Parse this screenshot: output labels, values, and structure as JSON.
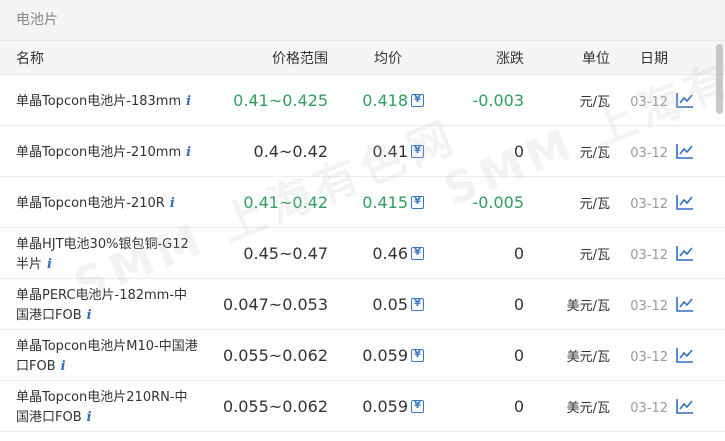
{
  "section_title": "电池片",
  "watermark": "SMM 上海有色网",
  "headers": {
    "name": "名称",
    "range": "价格范围",
    "avg": "均价",
    "change": "涨跌",
    "unit": "单位",
    "date": "日期"
  },
  "colors": {
    "up_green": "#2f9e5e",
    "neutral": "#333333",
    "accent_blue": "#2f6fc4"
  },
  "rows": [
    {
      "name": "单晶Topcon电池片-183mm",
      "range": "0.41~0.425",
      "avg": "0.418",
      "change": "-0.003",
      "unit": "元/瓦",
      "date": "03-12",
      "tone": "green"
    },
    {
      "name": "单晶Topcon电池片-210mm",
      "range": "0.4~0.42",
      "avg": "0.41",
      "change": "0",
      "unit": "元/瓦",
      "date": "03-12",
      "tone": "dark"
    },
    {
      "name": "单晶Topcon电池片-210R",
      "range": "0.41~0.42",
      "avg": "0.415",
      "change": "-0.005",
      "unit": "元/瓦",
      "date": "03-12",
      "tone": "green"
    },
    {
      "name": "单晶HJT电池30%银包铜-G12半片",
      "range": "0.45~0.47",
      "avg": "0.46",
      "change": "0",
      "unit": "元/瓦",
      "date": "03-12",
      "tone": "dark"
    },
    {
      "name": "单晶PERC电池片-182mm-中国港口FOB",
      "range": "0.047~0.053",
      "avg": "0.05",
      "change": "0",
      "unit": "美元/瓦",
      "date": "03-12",
      "tone": "dark"
    },
    {
      "name": "单晶Topcon电池片M10-中国港口FOB",
      "range": "0.055~0.062",
      "avg": "0.059",
      "change": "0",
      "unit": "美元/瓦",
      "date": "03-12",
      "tone": "dark"
    },
    {
      "name": "单晶Topcon电池片210RN-中国港口FOB",
      "range": "0.055~0.062",
      "avg": "0.059",
      "change": "0",
      "unit": "美元/瓦",
      "date": "03-12",
      "tone": "dark"
    }
  ]
}
